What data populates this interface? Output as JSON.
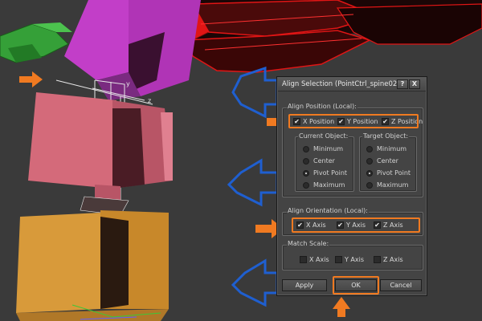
{
  "dialog": {
    "title": "Align Selection (PointCtrl_spine02)",
    "help_label": "?",
    "close_label": "X"
  },
  "align_position": {
    "label": "Align Position (Local):",
    "x_label": "X Position",
    "y_label": "Y Position",
    "z_label": "Z Position",
    "x_checked": true,
    "y_checked": true,
    "z_checked": true
  },
  "current_object": {
    "label": "Current Object:",
    "options": [
      "Minimum",
      "Center",
      "Pivot Point",
      "Maximum"
    ],
    "selected": "Pivot Point"
  },
  "target_object": {
    "label": "Target Object:",
    "options": [
      "Minimum",
      "Center",
      "Pivot Point",
      "Maximum"
    ],
    "selected": "Pivot Point"
  },
  "align_orientation": {
    "label": "Align Orientation (Local):",
    "x_label": "X Axis",
    "y_label": "Y Axis",
    "z_label": "Z Axis",
    "x_checked": true,
    "y_checked": true,
    "z_checked": true
  },
  "match_scale": {
    "label": "Match Scale:",
    "x_label": "X Axis",
    "y_label": "Y Axis",
    "z_label": "Z Axis",
    "x_checked": false,
    "y_checked": false,
    "z_checked": false
  },
  "buttons": {
    "apply": "Apply",
    "ok": "OK",
    "cancel": "Cancel"
  },
  "colors": {
    "highlight": "#f07a21",
    "viewport_bg": "#3a3a3a",
    "magenta": "#c23ec8",
    "red": "#e01010",
    "pink": "#d46a7a",
    "orange_box": "#d89a3a",
    "blue_arrow": "#1f5fd0",
    "green": "#3aa83a"
  }
}
